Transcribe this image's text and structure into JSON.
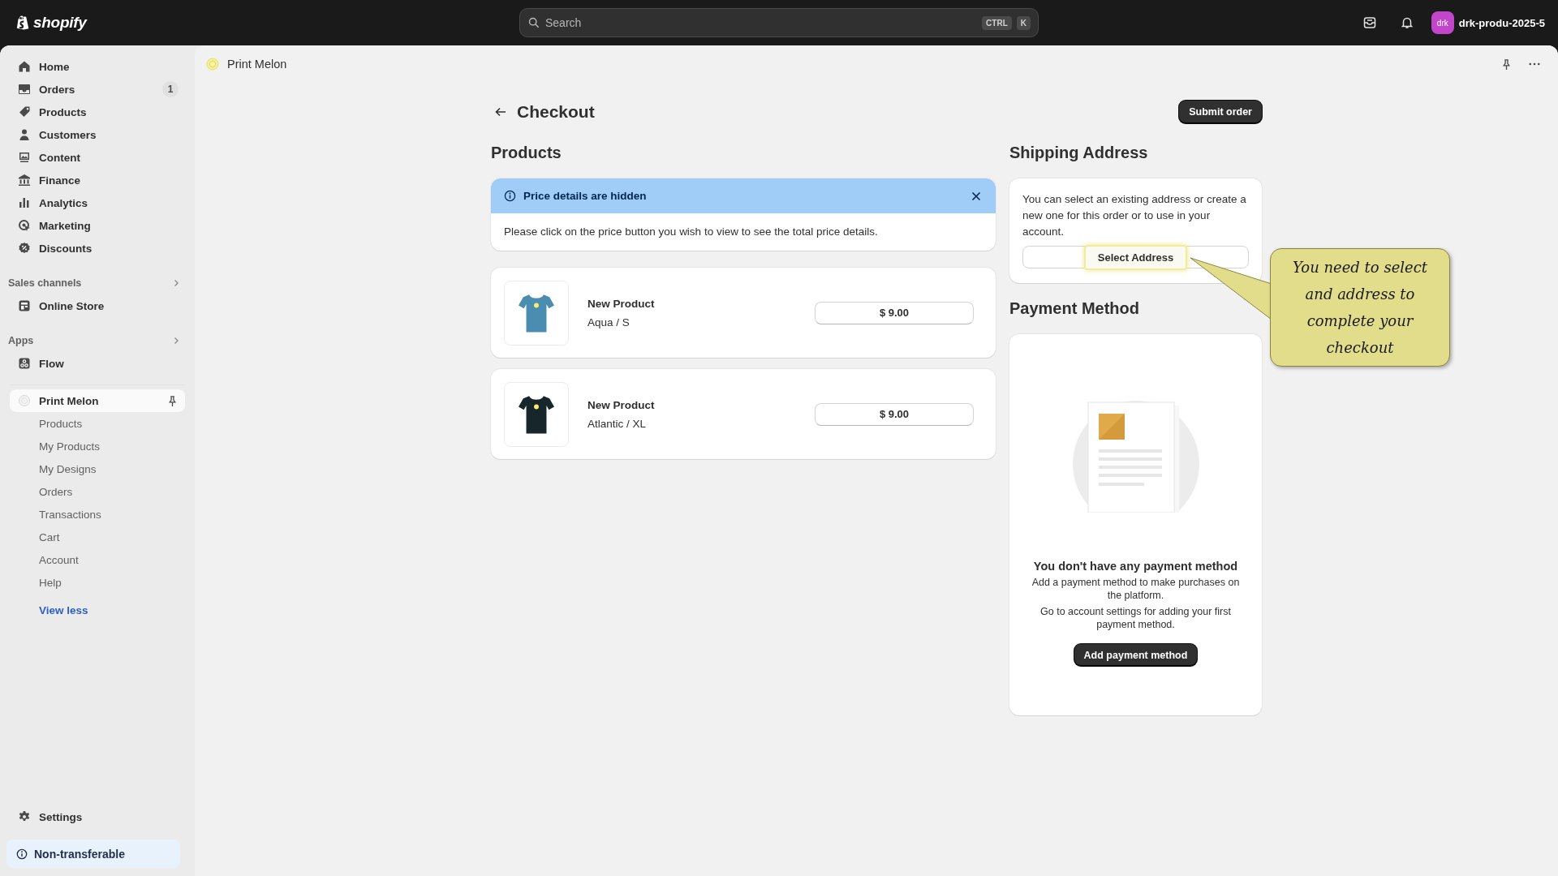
{
  "topbar": {
    "logo": "shopify",
    "search": {
      "placeholder": "Search",
      "keys": [
        "CTRL",
        "K"
      ]
    },
    "avatar": "drk",
    "store": "drk-produ-2025-5"
  },
  "sidebar": {
    "main": [
      {
        "label": "Home",
        "selected": false
      },
      {
        "label": "Orders",
        "badge": "1",
        "selected": false
      },
      {
        "label": "Products",
        "selected": false
      },
      {
        "label": "Customers",
        "selected": false
      },
      {
        "label": "Content",
        "selected": false
      },
      {
        "label": "Finance",
        "selected": false
      },
      {
        "label": "Analytics",
        "selected": false
      },
      {
        "label": "Marketing",
        "selected": false
      },
      {
        "label": "Discounts",
        "selected": false
      }
    ],
    "sections": [
      {
        "title": "Sales channels",
        "items": [
          {
            "label": "Online Store",
            "selected": false
          }
        ]
      },
      {
        "title": "Apps",
        "items": [
          {
            "label": "Flow",
            "selected": false
          }
        ]
      }
    ],
    "app": {
      "label": "Print Melon",
      "selected": true,
      "children": [
        {
          "label": "Products",
          "selected": false
        },
        {
          "label": "My Products",
          "selected": false
        },
        {
          "label": "My Designs",
          "selected": false
        },
        {
          "label": "Orders",
          "selected": false
        },
        {
          "label": "Transactions",
          "selected": false
        },
        {
          "label": "Cart",
          "selected": false
        },
        {
          "label": "Account",
          "selected": false
        },
        {
          "label": "Help",
          "selected": false
        }
      ]
    },
    "view_less": "View less",
    "settings": "Settings",
    "notice": "Non-transferable"
  },
  "page_header": {
    "app_name": "Print Melon"
  },
  "checkout": {
    "title": "Checkout",
    "submit": "Submit order",
    "products": {
      "heading": "Products",
      "banner": {
        "title": "Price details are hidden",
        "message": "Please click on the price button you wish to view to see the total price details."
      },
      "items": [
        {
          "name": "New Product",
          "variant": "Aqua / S",
          "price": "$ 9.00",
          "color": "#4a8db0"
        },
        {
          "name": "New Product",
          "variant": "Atlantic / XL",
          "price": "$ 9.00",
          "color": "#17262b"
        }
      ]
    },
    "shipping": {
      "heading": "Shipping Address",
      "text": "You can select an existing address or create a new one for this order or to use in your account.",
      "button": "Select Address"
    },
    "payment": {
      "heading": "Payment Method",
      "empty_title": "You don't have any payment method",
      "lines": [
        "Add a payment method to make purchases on the platform.",
        "Go to account settings for adding your first payment method."
      ],
      "button": "Add payment method"
    },
    "callout": {
      "text": "You need to select and address to complete your checkout"
    }
  }
}
